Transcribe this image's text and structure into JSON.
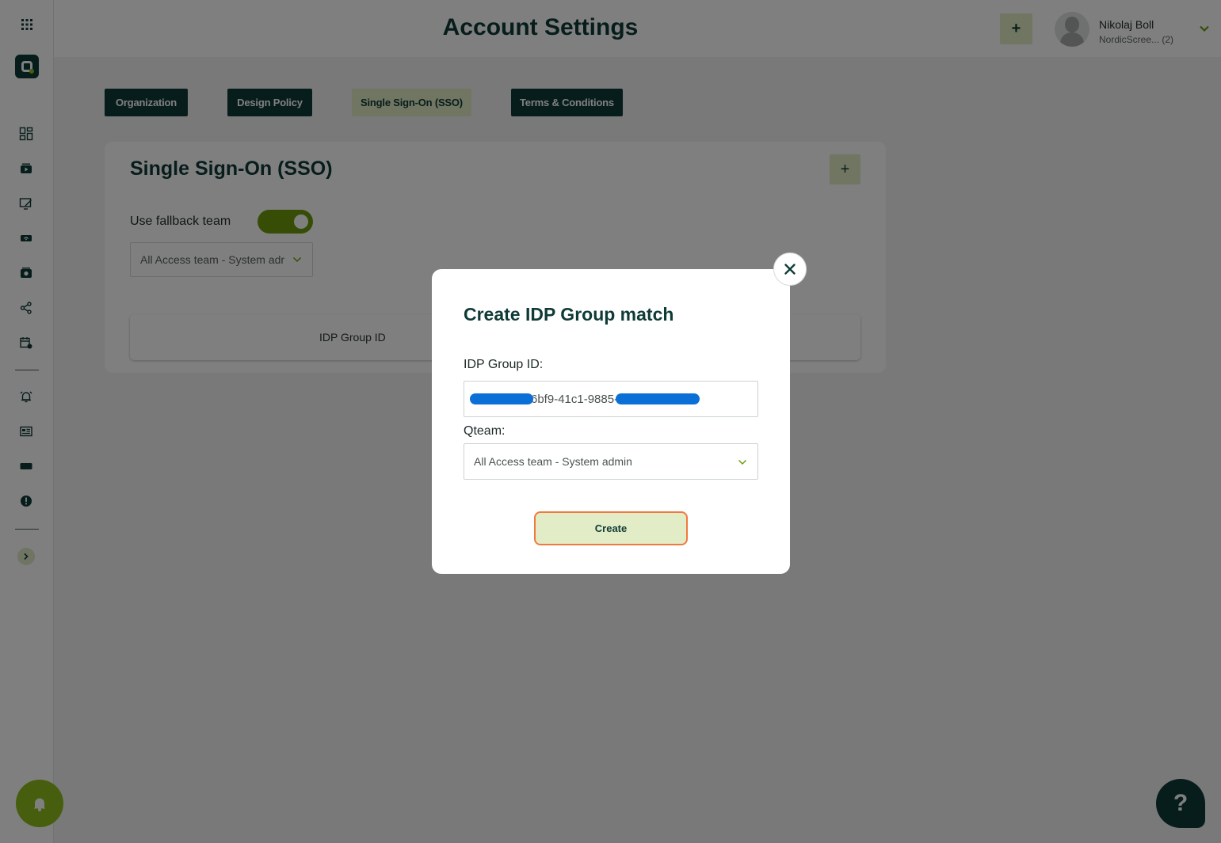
{
  "header": {
    "title": "Account Settings",
    "add_label": "+",
    "user": {
      "name": "Nikolaj Boll",
      "org": "NordicScree... (2)"
    }
  },
  "tabs": [
    {
      "label": "Organization",
      "active": false
    },
    {
      "label": "Design Policy",
      "active": false
    },
    {
      "label": "Single Sign-On (SSO)",
      "active": true
    },
    {
      "label": "Terms & Conditions",
      "active": false
    }
  ],
  "sso": {
    "title": "Single Sign-On (SSO)",
    "add_label": "+",
    "fallback_label": "Use fallback team",
    "fallback_enabled": true,
    "fallback_team": "All Access team - System adr",
    "table_headers": [
      "IDP Group ID"
    ]
  },
  "modal": {
    "title": "Create IDP Group match",
    "idp_label": "IDP Group ID:",
    "idp_value": "6bf9-41c1-9885-",
    "qteam_label": "Qteam:",
    "qteam_value": "All Access team - System admin",
    "create_label": "Create",
    "close_icon": "close-icon"
  },
  "help": {
    "label": "?"
  },
  "colors": {
    "brand_dark": "#0f3b37",
    "accent_green": "#8dbd1b",
    "toggle_green": "#6f9a0a",
    "pale_green": "#e2ecc6",
    "focus_orange": "#ef7a40",
    "redaction_blue": "#0a6fd6"
  }
}
